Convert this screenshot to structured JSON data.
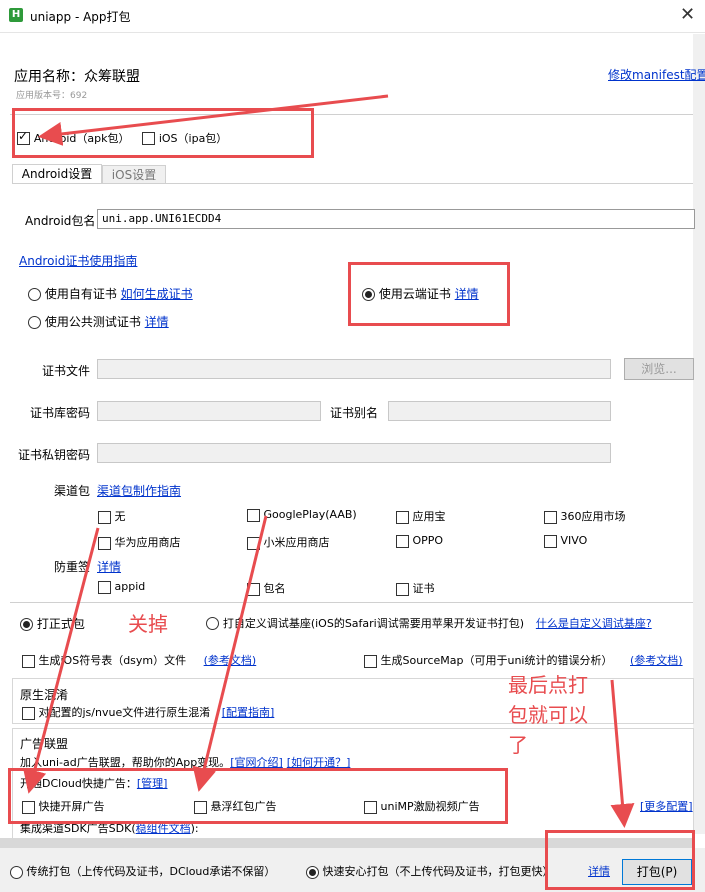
{
  "window": {
    "icon": "H",
    "title": "uniapp - App打包",
    "close": "✕"
  },
  "header": {
    "app_name": "应用名称：众筹联盟",
    "version": "应用版本号：692",
    "modify_manifest": "修改manifest配置"
  },
  "platforms": [
    {
      "label": "Android（apk包）",
      "checked": true
    },
    {
      "label": "iOS（ipa包）",
      "checked": false
    }
  ],
  "tabs": [
    "Android设置",
    "iOS设置"
  ],
  "android": {
    "package_label": "Android包名",
    "package_value": "uni.app.UNI61ECDD4",
    "cert_guide": "Android证书使用指南",
    "cert_options": {
      "own": "使用自有证书",
      "own_link": "如何生成证书",
      "public": "使用公共测试证书",
      "public_link": "详情",
      "cloud": "使用云端证书",
      "cloud_link": "详情"
    },
    "cert_file_label": "证书文件",
    "browse_button": "浏览...",
    "keystore_pwd_label": "证书库密码",
    "alias_label": "证书别名",
    "key_pwd_label": "证书私钥密码",
    "channel_label": "渠道包",
    "channel_guide": "渠道包制作指南",
    "channels": [
      [
        "无",
        "GooglePlay(AAB)",
        "应用宝",
        "360应用市场"
      ],
      [
        "华为应用商店",
        "小米应用商店",
        "OPPO",
        "VIVO"
      ]
    ],
    "anti_label": "防重签",
    "anti_link": "详情",
    "anti_items": [
      "appid",
      "包名",
      "证书"
    ]
  },
  "build_type": {
    "release": "打正式包",
    "custom": "打自定义调试基座(iOS的Safari调试需要用苹果开发证书打包)",
    "custom_link": "什么是自定义调试基座?"
  },
  "symbols": {
    "dsym": "生成iOS符号表（dsym）文件",
    "dsym_link": "(参考文档)",
    "sourcemap": "生成SourceMap（可用于uni统计的错误分析）",
    "sourcemap_link": "(参考文档)"
  },
  "native_obf": {
    "title": "原生混淆",
    "item": "对配置的js/nvue文件进行原生混淆",
    "link": "[配置指南]"
  },
  "ads": {
    "title": "广告联盟",
    "desc": "加入uni-ad广告联盟，帮助你的App变现。",
    "link1": "[官网介绍]",
    "link2": "[如何开通？]",
    "dcloud_label": "开通DCloud快捷广告：",
    "manage_link": "[管理]",
    "items": [
      "快捷开屏广告",
      "悬浮红包广告",
      "uniMP激励视频广告"
    ],
    "more": "[更多配置]",
    "sdk_label": "集成渠道SDK广告SDK(",
    "sdk_link": "稳组件文档",
    "sdk_end": "):"
  },
  "footer": {
    "traditional": "传统打包（上传代码及证书，DCloud承诺不保留）",
    "fast": "快速安心打包（不上传代码及证书，打包更快）",
    "detail": "详情",
    "pack_button": "打包(P)"
  },
  "annotations": {
    "close_note": "关掉",
    "final_note_line1": "最后点打",
    "final_note_line2": "包就可以",
    "final_note_line3": "了"
  },
  "colors": {
    "annotation": "#e84c4f",
    "link": "#0033cc"
  }
}
